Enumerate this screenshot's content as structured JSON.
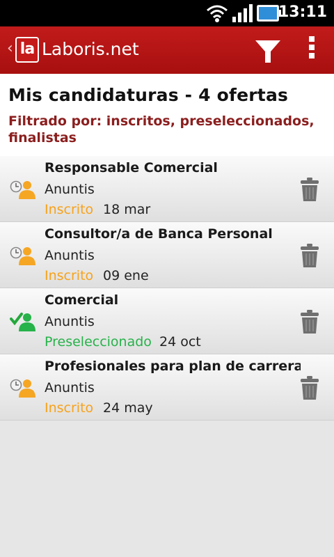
{
  "status_bar": {
    "time": "13:11"
  },
  "action_bar": {
    "title": "Laboris.net",
    "logo_text": "la"
  },
  "header": {
    "title": "Mis candidaturas - 4 ofertas",
    "filter": "Filtrado por: inscritos, preseleccionados, finalistas"
  },
  "colors": {
    "brand_red": "#b81616",
    "inscrito": "#f7a21b",
    "preseleccionado": "#27b24a",
    "filter_text": "#8b1e1e"
  },
  "items": [
    {
      "title": "Responsable Comercial",
      "company": "Anuntis",
      "status": "Inscrito",
      "date": "18 mar",
      "icon": "pending-user-icon"
    },
    {
      "title": "Consultor/a de Banca Personal",
      "company": "Anuntis",
      "status": "Inscrito",
      "date": "09 ene",
      "icon": "pending-user-icon"
    },
    {
      "title": "Comercial",
      "company": "Anuntis",
      "status": "Preseleccionado",
      "date": "24 oct",
      "icon": "approved-user-icon"
    },
    {
      "title": "Profesionales para plan de carrera ag",
      "company": "Anuntis",
      "status": "Inscrito",
      "date": "24 may",
      "icon": "pending-user-icon"
    }
  ]
}
